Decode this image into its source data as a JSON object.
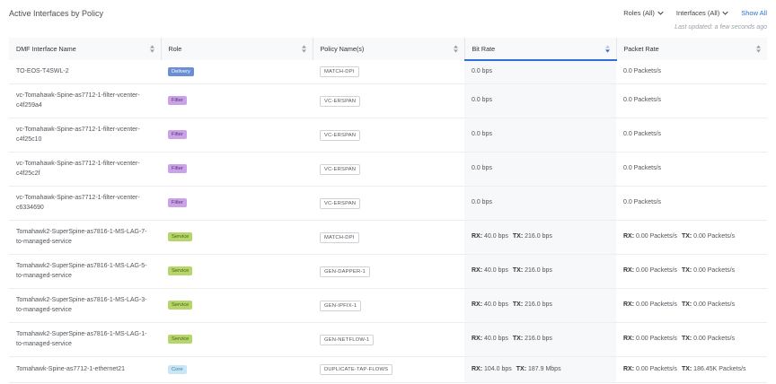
{
  "header": {
    "title": "Active Interfaces by Policy",
    "roles_filter": "Roles (All)",
    "interfaces_filter": "Interfaces (All)",
    "show_all": "Show All",
    "last_updated": "Last updated: a few seconds ago"
  },
  "columns": [
    "DMF Interface Name",
    "Role",
    "Policy Name(s)",
    "Bit Rate",
    "Packet Rate"
  ],
  "rows": [
    {
      "name": "TO-EOS-T4SWL-2",
      "role": "Delivery",
      "role_class": "delivery",
      "policy": "MATCH-DPI",
      "bit_rate": "0.0 bps",
      "packet_rate": "0.0 Packets/s"
    },
    {
      "name": "vc-Tomahawk-Spine-as7712-1-filter-vcenter-c4f259a4",
      "role": "Filter",
      "role_class": "filter",
      "policy": "VC-ERSPAN",
      "bit_rate": "0.0 bps",
      "packet_rate": "0.0 Packets/s"
    },
    {
      "name": "vc-Tomahawk-Spine-as7712-1-filter-vcenter-c4f25c10",
      "role": "Filter",
      "role_class": "filter",
      "policy": "VC-ERSPAN",
      "bit_rate": "0.0 bps",
      "packet_rate": "0.0 Packets/s"
    },
    {
      "name": "vc-Tomahawk-Spine-as7712-1-filter-vcenter-c4f25c2f",
      "role": "Filter",
      "role_class": "filter",
      "policy": "VC-ERSPAN",
      "bit_rate": "0.0 bps",
      "packet_rate": "0.0 Packets/s"
    },
    {
      "name": "vc-Tomahawk-Spine-as7712-1-filter-vcenter-c6334690",
      "role": "Filter",
      "role_class": "filter",
      "policy": "VC-ERSPAN",
      "bit_rate": "0.0 bps",
      "packet_rate": "0.0 Packets/s"
    },
    {
      "name": "Tomahawk2-SuperSpine-as7816-1-MS-LAG-7-to-managed-service",
      "role": "Service",
      "role_class": "service",
      "policy": "MATCH-DPI",
      "rx_bit": "40.0 bps",
      "tx_bit": "216.0 bps",
      "rx_pkt": "0.00 Packets/s",
      "tx_pkt": "0.00 Packets/s"
    },
    {
      "name": "Tomahawk2-SuperSpine-as7816-1-MS-LAG-5-to-managed-service",
      "role": "Service",
      "role_class": "service",
      "policy": "GEN-DAPPER-1",
      "rx_bit": "40.0 bps",
      "tx_bit": "216.0 bps",
      "rx_pkt": "0.00 Packets/s",
      "tx_pkt": "0.00 Packets/s"
    },
    {
      "name": "Tomahawk2-SuperSpine-as7816-1-MS-LAG-3-to-managed-service",
      "role": "Service",
      "role_class": "service",
      "policy": "GEN-IPFIX-1",
      "rx_bit": "40.0 bps",
      "tx_bit": "216.0 bps",
      "rx_pkt": "0.00 Packets/s",
      "tx_pkt": "0.00 Packets/s"
    },
    {
      "name": "Tomahawk2-SuperSpine-as7816-1-MS-LAG-1-to-managed-service",
      "role": "Service",
      "role_class": "service",
      "policy": "GEN-NETFLOW-1",
      "rx_bit": "40.0 bps",
      "tx_bit": "216.0 bps",
      "rx_pkt": "0.00 Packets/s",
      "tx_pkt": "0.00 Packets/s"
    },
    {
      "name": "Tomahawk-Spine-as7712-1-ethernet21",
      "role": "Core",
      "role_class": "core",
      "policy": "DUPLICATE-TAP-FLOWS",
      "rx_bit": "104.0 bps",
      "tx_bit": "187.9 Mbps",
      "rx_pkt": "0.00 Packets/s",
      "tx_pkt": "186.45K Packets/s"
    }
  ],
  "labels": {
    "rx": "RX:",
    "tx": "TX:"
  },
  "colors": {
    "accent": "#2f6fd6",
    "delivery": "#6b8fd6",
    "filter": "#c9a3e6",
    "service": "#b6d66b",
    "core": "#c8e6f5"
  },
  "icons": {
    "sort": "sort-icon",
    "dropdown": "chevron-down-icon"
  }
}
